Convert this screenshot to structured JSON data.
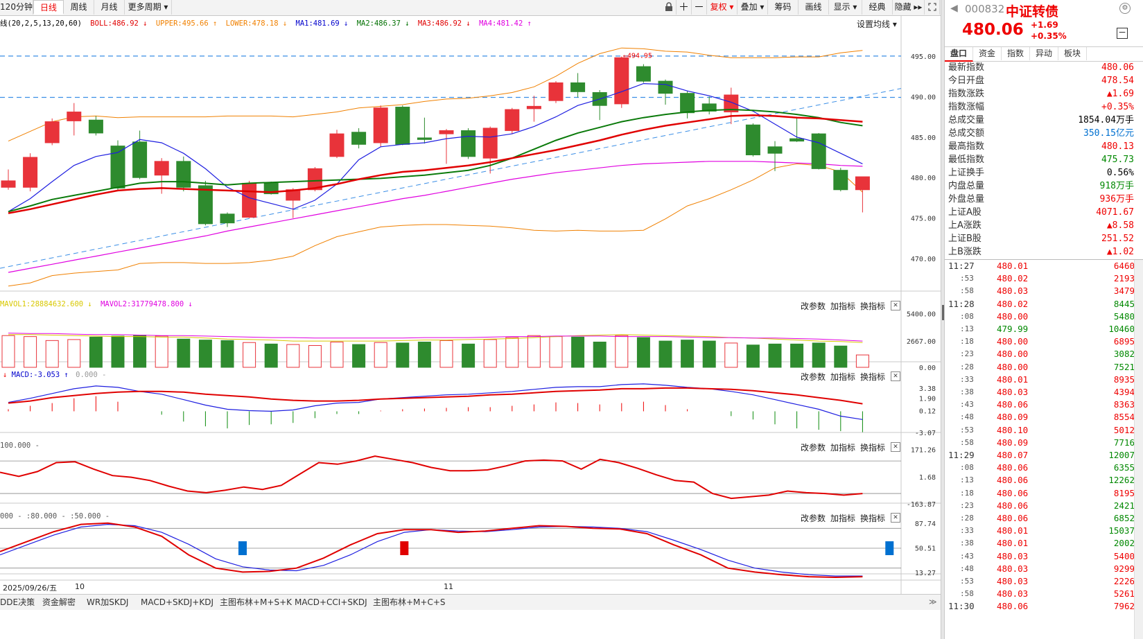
{
  "toolbar": {
    "periods": [
      "120分钟",
      "日线",
      "周线",
      "月线",
      "更多周期 ▾"
    ],
    "active_period": "日线",
    "right_buttons": [
      "复权 ▾",
      "叠加 ▾",
      "筹码",
      "画线",
      "显示 ▾",
      "经典",
      "隐藏 ▸▸"
    ]
  },
  "main_legend": {
    "prefix": "线(20,2,5,13,20,60)",
    "items": [
      {
        "text": "BOLL:486.92 ↓",
        "color": "#e00000"
      },
      {
        "text": "UPPER:495.66 ↑",
        "color": "#f08000"
      },
      {
        "text": "LOWER:478.18 ↓",
        "color": "#f08000"
      },
      {
        "text": "MA1:481.69 ↓",
        "color": "#0000cc"
      },
      {
        "text": "MA2:486.37 ↓",
        "color": "#007000"
      },
      {
        "text": "MA3:486.92 ↓",
        "color": "#e00000"
      },
      {
        "text": "MA4:481.42 ↑",
        "color": "#e000e0"
      }
    ],
    "settings": "设置均线 ▾"
  },
  "panel_controls": {
    "params": "改参数",
    "add": "加指标",
    "swap": "换指标",
    "close": "✕"
  },
  "vol_legend": {
    "mavol1": "MAVOL1:28884632.600 ↓",
    "mavol2": "MAVOL2:31779478.800 ↓"
  },
  "macd_legend": {
    "macd": "MACD:-3.053 ↑",
    "zero": "0.000 -"
  },
  "cci_legend": {
    "levels": "100.000 -"
  },
  "kdj_legend": {
    "levels": "000 - :80.000 - :50.000 -"
  },
  "date_axis": {
    "left_date": "2025/09/26/五",
    "labels": [
      "10",
      "11"
    ]
  },
  "bottom_tabs": [
    "DDE决策",
    "资金解密",
    "WR加SKDJ",
    "MACD+SKDJ+KDJ",
    "主图布林+M+S+K",
    "MACD+CCI+SKDJ",
    "主图布林+M+C+S"
  ],
  "quote": {
    "code": "000832",
    "name": "中证转债",
    "price": "480.06",
    "change": "+1.69",
    "change_pct": "+0.35%",
    "tabs": [
      "盘口",
      "资金",
      "指数",
      "异动",
      "板块"
    ],
    "rows": [
      {
        "label": "最新指数",
        "value": "480.06",
        "color": "#e00"
      },
      {
        "label": "今日开盘",
        "value": "478.54",
        "color": "#e00"
      },
      {
        "label": "指数涨跌",
        "value": "▲1.69",
        "color": "#e00"
      },
      {
        "label": "指数涨幅",
        "value": "+0.35%",
        "color": "#e00"
      },
      {
        "label": "总成交量",
        "value": "1854.04万手",
        "color": "#000"
      },
      {
        "label": "总成交额",
        "value": "350.15亿元",
        "color": "#0070d0"
      },
      {
        "label": "最高指数",
        "value": "480.13",
        "color": "#e00"
      },
      {
        "label": "最低指数",
        "value": "475.73",
        "color": "#080"
      },
      {
        "label": "上证换手",
        "value": "0.56%",
        "color": "#000"
      },
      {
        "label": "内盘总量",
        "value": "918万手",
        "color": "#080"
      },
      {
        "label": "外盘总量",
        "value": "936万手",
        "color": "#e00"
      },
      {
        "label": "上证A股",
        "value": "4071.67",
        "color": "#e00"
      },
      {
        "label": "上A涨跌",
        "value": "▲8.58",
        "color": "#e00"
      },
      {
        "label": "上证B股",
        "value": "251.52",
        "color": "#e00"
      },
      {
        "label": "上B涨跌",
        "value": "▲1.02",
        "color": "#e00"
      }
    ],
    "ticks": [
      {
        "t": "11:27",
        "p": "480.01",
        "v": "6460",
        "pc": "#e00",
        "vc": "#e00"
      },
      {
        "t": ":53",
        "p": "480.02",
        "v": "2193",
        "pc": "#e00",
        "vc": "#e00"
      },
      {
        "t": ":58",
        "p": "480.03",
        "v": "3479",
        "pc": "#e00",
        "vc": "#e00"
      },
      {
        "t": "11:28",
        "p": "480.02",
        "v": "8445",
        "pc": "#e00",
        "vc": "#080"
      },
      {
        "t": ":08",
        "p": "480.00",
        "v": "5480",
        "pc": "#e00",
        "vc": "#080"
      },
      {
        "t": ":13",
        "p": "479.99",
        "v": "10460",
        "pc": "#080",
        "vc": "#080"
      },
      {
        "t": ":18",
        "p": "480.00",
        "v": "6895",
        "pc": "#e00",
        "vc": "#e00"
      },
      {
        "t": ":23",
        "p": "480.00",
        "v": "3082",
        "pc": "#e00",
        "vc": "#080"
      },
      {
        "t": ":28",
        "p": "480.00",
        "v": "7521",
        "pc": "#e00",
        "vc": "#080"
      },
      {
        "t": ":33",
        "p": "480.01",
        "v": "8935",
        "pc": "#e00",
        "vc": "#e00"
      },
      {
        "t": ":38",
        "p": "480.03",
        "v": "4394",
        "pc": "#e00",
        "vc": "#e00"
      },
      {
        "t": ":43",
        "p": "480.06",
        "v": "8363",
        "pc": "#e00",
        "vc": "#e00"
      },
      {
        "t": ":48",
        "p": "480.09",
        "v": "8554",
        "pc": "#e00",
        "vc": "#e00"
      },
      {
        "t": ":53",
        "p": "480.10",
        "v": "5012",
        "pc": "#e00",
        "vc": "#e00"
      },
      {
        "t": ":58",
        "p": "480.09",
        "v": "7716",
        "pc": "#e00",
        "vc": "#080"
      },
      {
        "t": "11:29",
        "p": "480.07",
        "v": "12007",
        "pc": "#e00",
        "vc": "#080"
      },
      {
        "t": ":08",
        "p": "480.06",
        "v": "6355",
        "pc": "#e00",
        "vc": "#080"
      },
      {
        "t": ":13",
        "p": "480.06",
        "v": "12262",
        "pc": "#e00",
        "vc": "#080"
      },
      {
        "t": ":18",
        "p": "480.06",
        "v": "8195",
        "pc": "#e00",
        "vc": "#e00"
      },
      {
        "t": ":23",
        "p": "480.06",
        "v": "2421",
        "pc": "#e00",
        "vc": "#080"
      },
      {
        "t": ":28",
        "p": "480.06",
        "v": "6852",
        "pc": "#e00",
        "vc": "#080"
      },
      {
        "t": ":33",
        "p": "480.01",
        "v": "15037",
        "pc": "#e00",
        "vc": "#080"
      },
      {
        "t": ":38",
        "p": "480.01",
        "v": "2002",
        "pc": "#e00",
        "vc": "#080"
      },
      {
        "t": ":43",
        "p": "480.03",
        "v": "5400",
        "pc": "#e00",
        "vc": "#e00"
      },
      {
        "t": ":48",
        "p": "480.03",
        "v": "9299",
        "pc": "#e00",
        "vc": "#e00"
      },
      {
        "t": ":53",
        "p": "480.03",
        "v": "2226",
        "pc": "#e00",
        "vc": "#e00"
      },
      {
        "t": ":58",
        "p": "480.03",
        "v": "5261",
        "pc": "#e00",
        "vc": "#e00"
      },
      {
        "t": "11:30",
        "p": "480.06",
        "v": "7962",
        "pc": "#e00",
        "vc": "#e00"
      }
    ]
  },
  "chart_data": {
    "type": "candlestick",
    "price_axis": {
      "ticks": [
        "495.00",
        "490.00",
        "485.00",
        "480.00",
        "475.00",
        "470.00"
      ],
      "range": [
        466.5,
        498.5
      ]
    },
    "annotation": "494.95",
    "candles": [
      {
        "o": 478.8,
        "c": 479.6,
        "h": 481.0,
        "l": 478.5
      },
      {
        "o": 478.8,
        "c": 482.5,
        "h": 483.0,
        "l": 478.3
      },
      {
        "o": 484.3,
        "c": 486.9,
        "h": 487.3,
        "l": 484.0
      },
      {
        "o": 487.0,
        "c": 488.1,
        "h": 489.2,
        "l": 485.2
      },
      {
        "o": 487.1,
        "c": 485.5,
        "h": 487.6,
        "l": 485.2
      },
      {
        "o": 483.9,
        "c": 478.7,
        "h": 484.6,
        "l": 478.4
      },
      {
        "o": 484.4,
        "c": 480.0,
        "h": 485.8,
        "l": 479.8
      },
      {
        "o": 480.3,
        "c": 482.0,
        "h": 482.4,
        "l": 478.0
      },
      {
        "o": 482.0,
        "c": 478.8,
        "h": 482.6,
        "l": 478.3
      },
      {
        "o": 479.0,
        "c": 474.3,
        "h": 479.6,
        "l": 474.1
      },
      {
        "o": 475.5,
        "c": 474.4,
        "h": 475.7,
        "l": 473.9
      },
      {
        "o": 475.1,
        "c": 479.3,
        "h": 479.6,
        "l": 475.0
      },
      {
        "o": 479.3,
        "c": 478.0,
        "h": 479.5,
        "l": 477.9
      },
      {
        "o": 477.2,
        "c": 478.5,
        "h": 478.7,
        "l": 475.0
      },
      {
        "o": 478.5,
        "c": 481.1,
        "h": 481.3,
        "l": 478.3
      },
      {
        "o": 482.6,
        "c": 485.4,
        "h": 485.9,
        "l": 482.4
      },
      {
        "o": 485.6,
        "c": 484.1,
        "h": 486.1,
        "l": 483.6
      },
      {
        "o": 484.3,
        "c": 488.6,
        "h": 488.9,
        "l": 483.8
      },
      {
        "o": 488.7,
        "c": 484.1,
        "h": 488.9,
        "l": 484.0
      },
      {
        "o": 484.9,
        "c": 484.7,
        "h": 487.4,
        "l": 484.2
      },
      {
        "o": 485.4,
        "c": 485.8,
        "h": 486.0,
        "l": 481.7
      },
      {
        "o": 485.8,
        "c": 482.6,
        "h": 486.1,
        "l": 482.3
      },
      {
        "o": 482.4,
        "c": 486.1,
        "h": 486.3,
        "l": 480.5
      },
      {
        "o": 485.8,
        "c": 488.4,
        "h": 488.6,
        "l": 485.4
      },
      {
        "o": 488.5,
        "c": 488.8,
        "h": 490.1,
        "l": 486.9
      },
      {
        "o": 489.5,
        "c": 491.7,
        "h": 491.9,
        "l": 489.2
      },
      {
        "o": 491.7,
        "c": 490.6,
        "h": 492.9,
        "l": 489.9
      },
      {
        "o": 490.5,
        "c": 488.9,
        "h": 490.8,
        "l": 487.1
      },
      {
        "o": 489.1,
        "c": 494.8,
        "h": 494.95,
        "l": 488.6
      },
      {
        "o": 493.7,
        "c": 491.9,
        "h": 494.0,
        "l": 491.7
      },
      {
        "o": 491.9,
        "c": 490.4,
        "h": 492.1,
        "l": 489.0
      },
      {
        "o": 490.4,
        "c": 488.0,
        "h": 490.7,
        "l": 487.3
      },
      {
        "o": 489.1,
        "c": 488.2,
        "h": 490.0,
        "l": 487.8
      },
      {
        "o": 488.1,
        "c": 490.2,
        "h": 491.1,
        "l": 486.6
      },
      {
        "o": 486.5,
        "c": 482.8,
        "h": 486.7,
        "l": 482.6
      },
      {
        "o": 483.8,
        "c": 483.0,
        "h": 484.5,
        "l": 480.8
      },
      {
        "o": 484.8,
        "c": 484.5,
        "h": 487.5,
        "l": 484.4
      },
      {
        "o": 485.4,
        "c": 481.1,
        "h": 485.5,
        "l": 481.0
      },
      {
        "o": 480.9,
        "c": 478.5,
        "h": 481.2,
        "l": 478.3
      },
      {
        "o": 478.5,
        "c": 480.1,
        "h": 480.1,
        "l": 475.7
      }
    ],
    "ma1": [
      475.8,
      477.4,
      479.5,
      481.5,
      482.6,
      483.1,
      484.7,
      484.3,
      483.0,
      481.1,
      478.8,
      477.5,
      476.8,
      476.1,
      477.2,
      479.2,
      482.2,
      483.8,
      484.1,
      484.3,
      484.8,
      485.1,
      485.0,
      485.4,
      486.3,
      487.5,
      488.9,
      489.7,
      490.6,
      491.6,
      491.5,
      490.7,
      490.1,
      489.3,
      488.2,
      486.6,
      485.0,
      484.3,
      483.0,
      481.7
    ],
    "ma2": [
      475.8,
      476.5,
      477.3,
      477.8,
      478.3,
      478.8,
      479.3,
      479.5,
      479.5,
      479.3,
      479.1,
      479.3,
      479.4,
      479.5,
      479.6,
      479.7,
      479.8,
      479.9,
      480.1,
      480.3,
      480.6,
      480.9,
      481.5,
      482.4,
      483.5,
      484.6,
      485.5,
      486.2,
      486.9,
      487.4,
      487.8,
      488.1,
      488.3,
      488.4,
      488.3,
      488.1,
      487.8,
      487.4,
      486.8,
      486.4
    ],
    "ma3": [
      475.6,
      476.1,
      476.7,
      477.3,
      477.9,
      478.4,
      478.6,
      478.7,
      478.6,
      478.5,
      478.4,
      478.3,
      478.2,
      478.4,
      478.7,
      479.2,
      479.8,
      480.3,
      480.7,
      480.9,
      481.2,
      481.5,
      481.9,
      482.4,
      482.9,
      483.4,
      484.0,
      484.6,
      485.3,
      485.9,
      486.4,
      486.8,
      487.2,
      487.6,
      487.7,
      487.6,
      487.4,
      487.3,
      487.1,
      486.9
    ],
    "ma4": [
      468.3,
      468.8,
      469.3,
      469.8,
      470.3,
      470.8,
      471.3,
      471.8,
      472.3,
      472.8,
      473.4,
      473.9,
      474.4,
      474.9,
      475.4,
      475.9,
      476.4,
      476.9,
      477.4,
      477.8,
      478.3,
      478.8,
      479.3,
      479.8,
      480.2,
      480.6,
      480.9,
      481.2,
      481.5,
      481.7,
      481.8,
      481.9,
      482.0,
      482.0,
      482.0,
      481.9,
      481.8,
      481.7,
      481.5,
      481.4
    ],
    "upper": [
      484.5,
      485.7,
      486.9,
      487.5,
      487.6,
      487.4,
      487.5,
      487.5,
      487.5,
      487.5,
      487.6,
      487.6,
      487.6,
      487.5,
      487.8,
      488.1,
      488.6,
      488.8,
      489.0,
      489.4,
      489.7,
      489.8,
      490.1,
      490.5,
      491.2,
      492.5,
      494.1,
      495.3,
      496.0,
      495.9,
      495.6,
      495.5,
      495.1,
      494.8,
      494.8,
      494.8,
      494.9,
      494.9,
      495.4,
      495.7
    ],
    "lower": [
      466.6,
      467.0,
      467.9,
      468.2,
      468.4,
      468.6,
      469.4,
      469.5,
      469.5,
      469.4,
      469.4,
      469.5,
      469.8,
      470.3,
      471.6,
      472.7,
      473.3,
      473.9,
      474.1,
      474.2,
      474.2,
      474.1,
      474.0,
      473.8,
      473.5,
      473.4,
      473.5,
      473.4,
      473.4,
      473.5,
      474.9,
      476.5,
      477.4,
      478.5,
      479.7,
      481.2,
      481.7,
      481.5,
      480.7,
      478.2
    ],
    "dashed_levels": [
      495.0,
      489.9
    ],
    "trendline": [
      468.8,
      491.0
    ],
    "volume": {
      "axis": [
        "5400.00",
        "2667.00",
        "0.00"
      ],
      "max": 5800,
      "values": [
        3200,
        3100,
        2700,
        2800,
        3050,
        3150,
        3250,
        3150,
        2850,
        2750,
        2700,
        2500,
        2350,
        2300,
        2200,
        2550,
        2300,
        2500,
        2450,
        2550,
        2700,
        2350,
        2800,
        3000,
        3200,
        3100,
        3050,
        2550,
        3200,
        3000,
        2650,
        2750,
        2650,
        2450,
        2250,
        2350,
        2350,
        2450,
        2150,
        1250
      ],
      "mavol1": [
        3300,
        3300,
        3250,
        3200,
        3150,
        3100,
        3100,
        3050,
        3050,
        2950,
        2850,
        2800,
        2750,
        2650,
        2650,
        2650,
        2650,
        2650,
        2700,
        2750,
        2750,
        2800,
        2850,
        2900,
        3000,
        3100,
        3200,
        3250,
        3300,
        3250,
        3200,
        3150,
        3100,
        3000,
        2950,
        2850,
        2750,
        2650,
        2600,
        2500
      ],
      "mavol2": [
        3450,
        3400,
        3400,
        3350,
        3300,
        3300,
        3250,
        3200,
        3200,
        3150,
        3100,
        3050,
        3000,
        3000,
        2950,
        2950,
        2950,
        2950,
        2950,
        3000,
        3000,
        3000,
        3050,
        3100,
        3100,
        3150,
        3150,
        3150,
        3100,
        3100,
        3100,
        3050,
        3000,
        3000,
        2950,
        2950,
        2900,
        2850,
        2750,
        2650
      ]
    },
    "macd": {
      "axis": [
        "3.38",
        "1.90",
        "0.12",
        "-3.07"
      ],
      "range": [
        -3.5,
        4.5
      ],
      "dif": [
        1.3,
        1.9,
        2.6,
        3.3,
        3.7,
        3.5,
        2.9,
        2.5,
        1.7,
        0.9,
        0.3,
        0.1,
        0.0,
        0.2,
        0.8,
        1.2,
        1.3,
        1.8,
        2.0,
        2.2,
        2.4,
        2.5,
        2.7,
        2.9,
        3.2,
        3.5,
        3.6,
        3.6,
        3.9,
        4.0,
        3.8,
        3.5,
        3.3,
        2.9,
        2.4,
        1.7,
        1.0,
        0.3,
        -0.7,
        -1.2
      ],
      "dea": [
        1.2,
        1.5,
        2.0,
        2.3,
        2.6,
        2.8,
        2.9,
        2.9,
        2.8,
        2.5,
        2.3,
        2.1,
        1.8,
        1.6,
        1.5,
        1.5,
        1.6,
        1.8,
        1.9,
        2.0,
        2.1,
        2.2,
        2.4,
        2.5,
        2.7,
        2.9,
        3.0,
        3.1,
        3.3,
        3.3,
        3.4,
        3.4,
        3.3,
        3.2,
        3.0,
        2.7,
        2.4,
        2.0,
        1.6,
        1.1
      ],
      "hist": [
        0.3,
        0.8,
        1.2,
        1.9,
        2.2,
        1.4,
        0.0,
        -0.5,
        -1.5,
        -2.2,
        -2.5,
        -2.0,
        -1.9,
        -1.7,
        -1.0,
        -0.4,
        -0.4,
        0.1,
        0.3,
        0.4,
        0.5,
        0.6,
        0.6,
        0.8,
        1.0,
        1.3,
        1.2,
        1.0,
        1.2,
        1.4,
        0.9,
        0.3,
        0.0,
        -0.7,
        -1.2,
        -1.9,
        -2.5,
        -2.7,
        -2.9,
        -3.05
      ]
    },
    "cci": {
      "axis": [
        "171.26",
        "1.68",
        "-163.87"
      ],
      "range": [
        -185,
        190
      ],
      "line": [
        30,
        5,
        35,
        90,
        95,
        50,
        10,
        0,
        -20,
        -55,
        -85,
        -95,
        -80,
        -60,
        -75,
        -50,
        20,
        90,
        80,
        100,
        130,
        110,
        90,
        60,
        40,
        40,
        45,
        70,
        100,
        105,
        100,
        50,
        110,
        90,
        55,
        15,
        -20,
        -30,
        -100,
        -130,
        -120,
        -110,
        -85,
        -95,
        -100,
        -110,
        -100
      ]
    },
    "kdj": {
      "axis": [
        "87.74",
        "50.51",
        "13.27"
      ],
      "range": [
        5,
        95
      ],
      "k": [
        45,
        60,
        75,
        86,
        88,
        82,
        68,
        40,
        20,
        14,
        15,
        20,
        35,
        55,
        72,
        78,
        78,
        74,
        76,
        80,
        84,
        83,
        80,
        79,
        72,
        55,
        40,
        20,
        14,
        10,
        7,
        6,
        7
      ],
      "d": [
        40,
        55,
        70,
        82,
        86,
        84,
        74,
        56,
        34,
        22,
        17,
        16,
        24,
        40,
        60,
        74,
        78,
        76,
        75,
        78,
        82,
        83,
        82,
        80,
        75,
        62,
        48,
        32,
        20,
        14,
        10,
        8,
        8
      ],
      "j_markers": [
        {
          "i": 9,
          "c": "#0070d0"
        },
        {
          "i": 15,
          "c": "#e00000"
        },
        {
          "i": 33,
          "c": "#0070d0"
        }
      ]
    }
  }
}
